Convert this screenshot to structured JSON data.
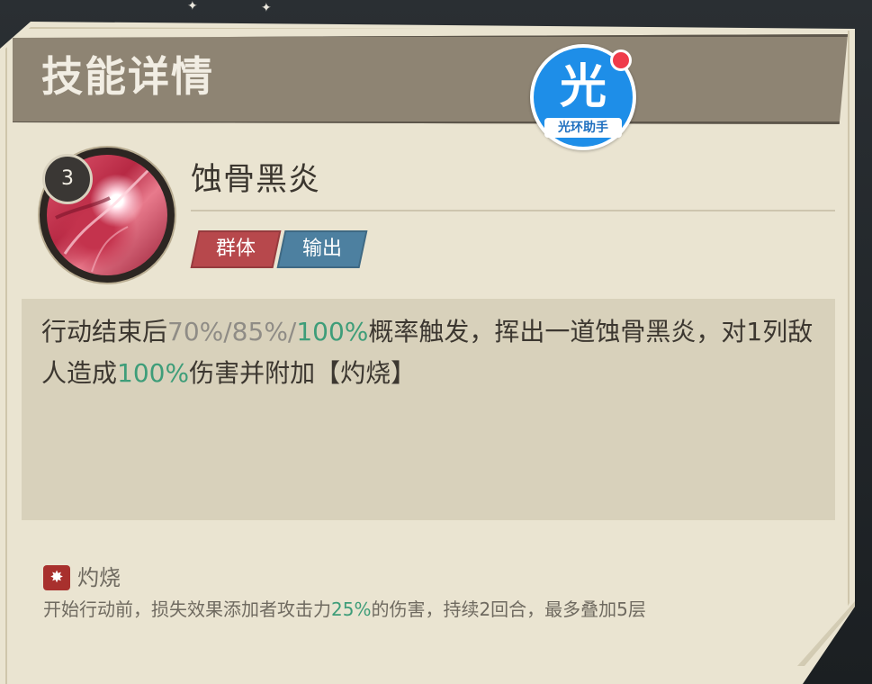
{
  "header": {
    "title": "技能详情"
  },
  "watermark": {
    "glyph": "光",
    "caption": "光环助手"
  },
  "skill": {
    "level": "3",
    "name": "蚀骨黑炎",
    "tags": [
      {
        "label": "群体",
        "color": "#b7484c"
      },
      {
        "label": "输出",
        "color": "#4d80a0"
      }
    ],
    "description": {
      "pre": "行动结束后",
      "chance_values": "70%/85%/",
      "chance_max": "100%",
      "mid1": "概率触发，挥出一道蚀骨黑炎，对1列敌人造成",
      "damage": "100%",
      "post": "伤害并附加【灼烧】"
    }
  },
  "status": {
    "icon": "fire-status-icon",
    "name": "灼烧",
    "desc_pre": "开始行动前，损失效果添加者攻击力",
    "desc_value": "25%",
    "desc_post": "的伤害，持续2回合，最多叠加5层"
  },
  "colors": {
    "highlight_green": "#3e9d79",
    "muted_gray": "#8f8c86",
    "card_bg": "#eae4d1",
    "header_bg": "#8e8473"
  }
}
